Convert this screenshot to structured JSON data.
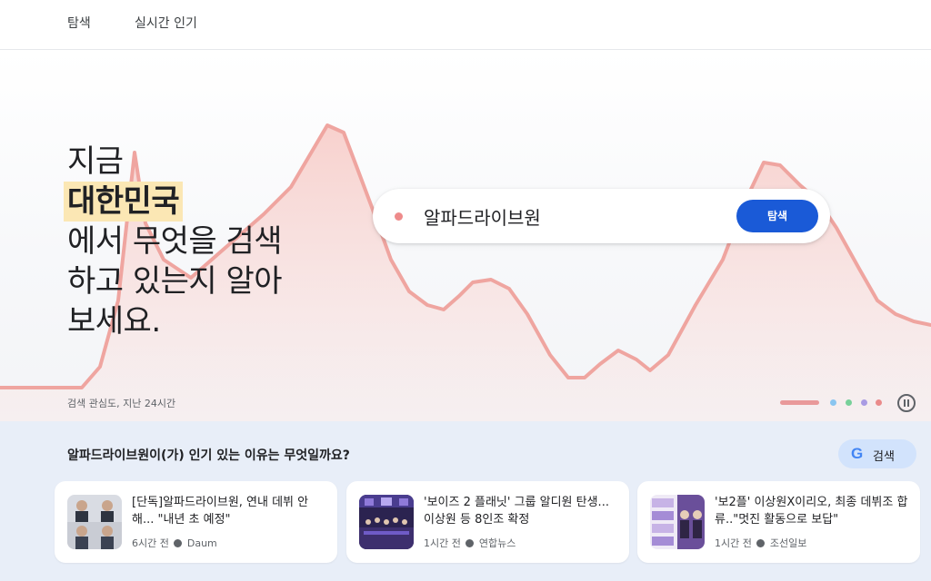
{
  "nav": {
    "tabs": [
      {
        "label": "탐색"
      },
      {
        "label": "실시간 인기"
      }
    ]
  },
  "hero": {
    "headline": {
      "line1": "지금",
      "highlight": "대한민국",
      "line3": "에서 무엇을 검색",
      "line4": "하고 있는지 알아",
      "line5": "보세요."
    },
    "search": {
      "term": "알파드라이브원",
      "button_label": "탐색",
      "dot_color": "#ee8b8b"
    },
    "caption": "검색 관심도, 지난 24시간",
    "carousel_colors": [
      "#e9999a",
      "#8ac5f0",
      "#78d09a",
      "#a99be3",
      "#ea8b8b"
    ],
    "chart_color": "#efa5a0"
  },
  "related": {
    "question": "알파드라이브원이(가) 인기 있는 이유는 무엇일까요?",
    "google_button": {
      "icon": "google-g-icon",
      "label": "검색"
    },
    "articles": [
      {
        "title": "[단독]알파드라이브원, 연내 데뷔 안해... \"내년 초 예정\"",
        "time": "6시간 전",
        "source": "Daum"
      },
      {
        "title": "'보이즈 2 플래닛' 그룹 알디원 탄생... 이상원 등 8인조 확정",
        "time": "1시간 전",
        "source": "연합뉴스"
      },
      {
        "title": "'보2플' 이상원X이리오, 최종 데뷔조 합류..\"멋진 활동으로 보답\"",
        "time": "1시간 전",
        "source": "조선일보"
      }
    ]
  }
}
